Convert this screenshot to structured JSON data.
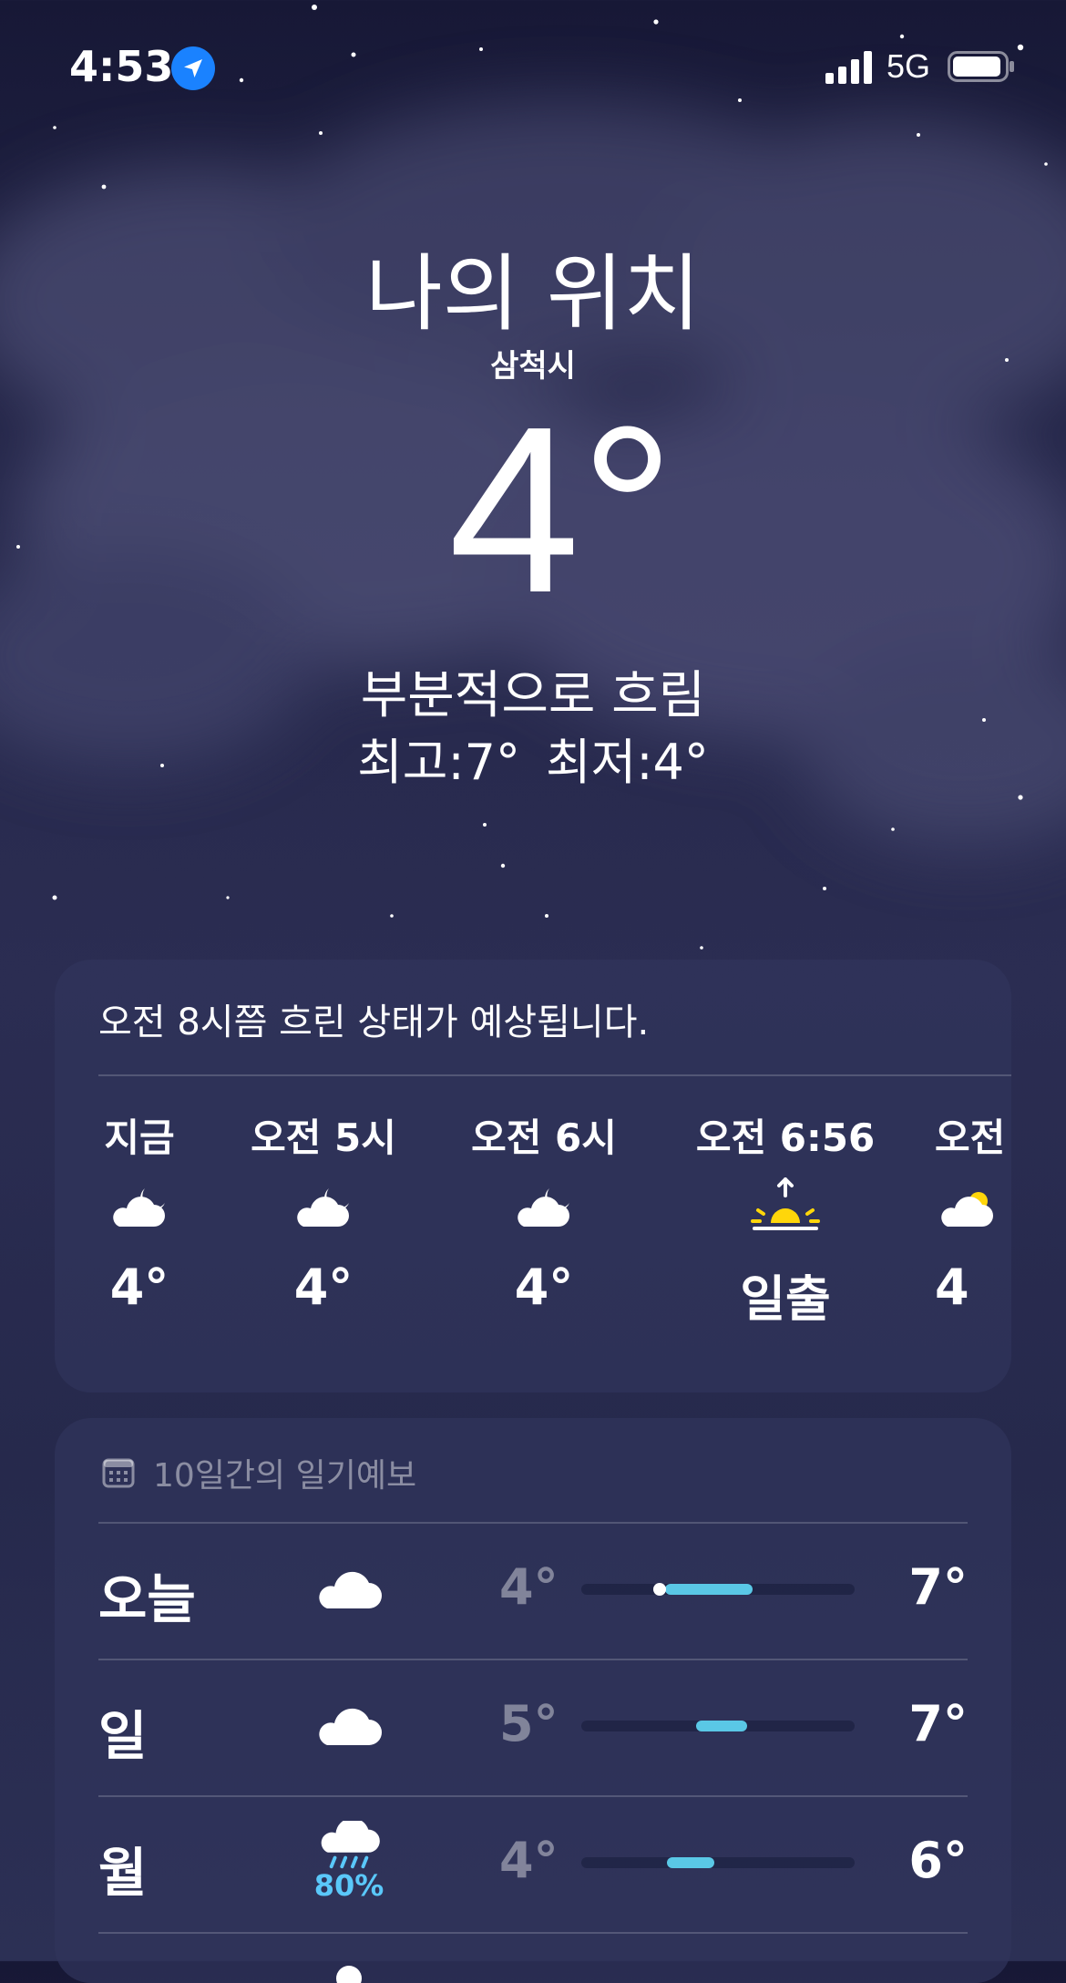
{
  "status": {
    "time": "4:53",
    "network": "5G"
  },
  "location": {
    "title": "나의 위치",
    "city": "삼척시"
  },
  "current": {
    "temp": "4°",
    "condition": "부분적으로 흐림",
    "high": "최고:7°",
    "low": "최저:4°"
  },
  "hourly": {
    "summary": "오전 8시쯤 흐린 상태가 예상됩니다.",
    "items": [
      {
        "label": "지금",
        "icon": "cloud-moon-icon",
        "value": "4°"
      },
      {
        "label": "오전 5시",
        "icon": "cloud-moon-icon",
        "value": "4°"
      },
      {
        "label": "오전 6시",
        "icon": "cloud-moon-icon",
        "value": "4°"
      },
      {
        "label": "오전 6:56",
        "icon": "sunrise-icon",
        "value": "일출"
      },
      {
        "label": "오전",
        "icon": "cloud-sun-icon",
        "value": "4"
      }
    ]
  },
  "daily": {
    "header": "10일간의 일기예보",
    "days": [
      {
        "day": "오늘",
        "icon": "cloud-icon",
        "precip": "",
        "low": "4°",
        "high": "7°"
      },
      {
        "day": "일",
        "icon": "cloud-icon",
        "precip": "",
        "low": "5°",
        "high": "7°"
      },
      {
        "day": "월",
        "icon": "cloud-rain-icon",
        "precip": "80%",
        "low": "4°",
        "high": "6°"
      }
    ]
  },
  "colors": {
    "accent_blue": "#1a82ff",
    "range_bar": "#5ac8e6",
    "sun_yellow": "#ffd60a"
  }
}
